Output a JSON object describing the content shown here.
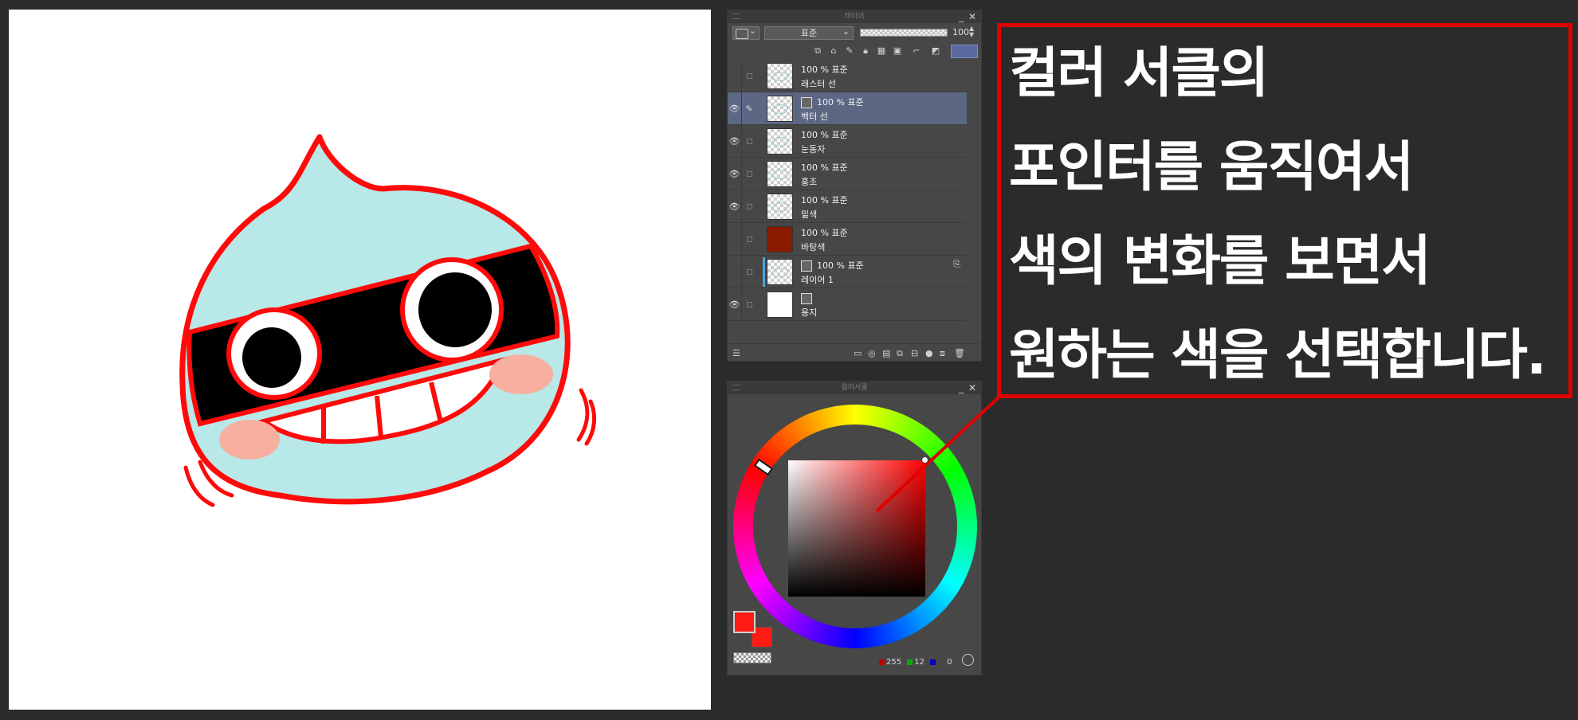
{
  "layer_panel": {
    "title": "레이어",
    "minimize": "_",
    "close": "✕",
    "blend_mode": "표준",
    "opacity_value": "100",
    "opacity_fraction": 1.0,
    "layers": [
      {
        "opacity_mode": "100 % 표준",
        "name": "래스터 선",
        "visible": false,
        "selected": false
      },
      {
        "opacity_mode": "100 % 표준",
        "name": "벡터 선",
        "visible": true,
        "selected": true
      },
      {
        "opacity_mode": "100 % 표준",
        "name": "눈동자",
        "visible": true,
        "selected": false
      },
      {
        "opacity_mode": "100 % 표준",
        "name": "홍조",
        "visible": true,
        "selected": false
      },
      {
        "opacity_mode": "100 % 표준",
        "name": "밑색",
        "visible": true,
        "selected": false
      },
      {
        "opacity_mode": "100 % 표준",
        "name": "바탕색",
        "visible": false,
        "selected": false
      },
      {
        "opacity_mode": "100 % 표준",
        "name": "레이어 1",
        "visible": false,
        "selected": false
      },
      {
        "opacity_mode": "",
        "name": "용지",
        "visible": true,
        "selected": false
      }
    ]
  },
  "color_panel": {
    "title": "컬러서클",
    "minimize": "_",
    "close": "✕",
    "main_color": "#ff1a14",
    "sub_color": "#ff1a14",
    "rgb": {
      "r": "255",
      "g": "12",
      "b": "0"
    }
  },
  "annotation": {
    "lines": [
      "컬러 서클의",
      "포인터를 움직여서",
      "색의 변화를 보면서",
      "원하는 색을 선택합니다."
    ],
    "border_color": "#e00000"
  },
  "icons": {
    "eye": "eye-icon",
    "pen": "pen-icon",
    "paper": "paper-icon"
  }
}
